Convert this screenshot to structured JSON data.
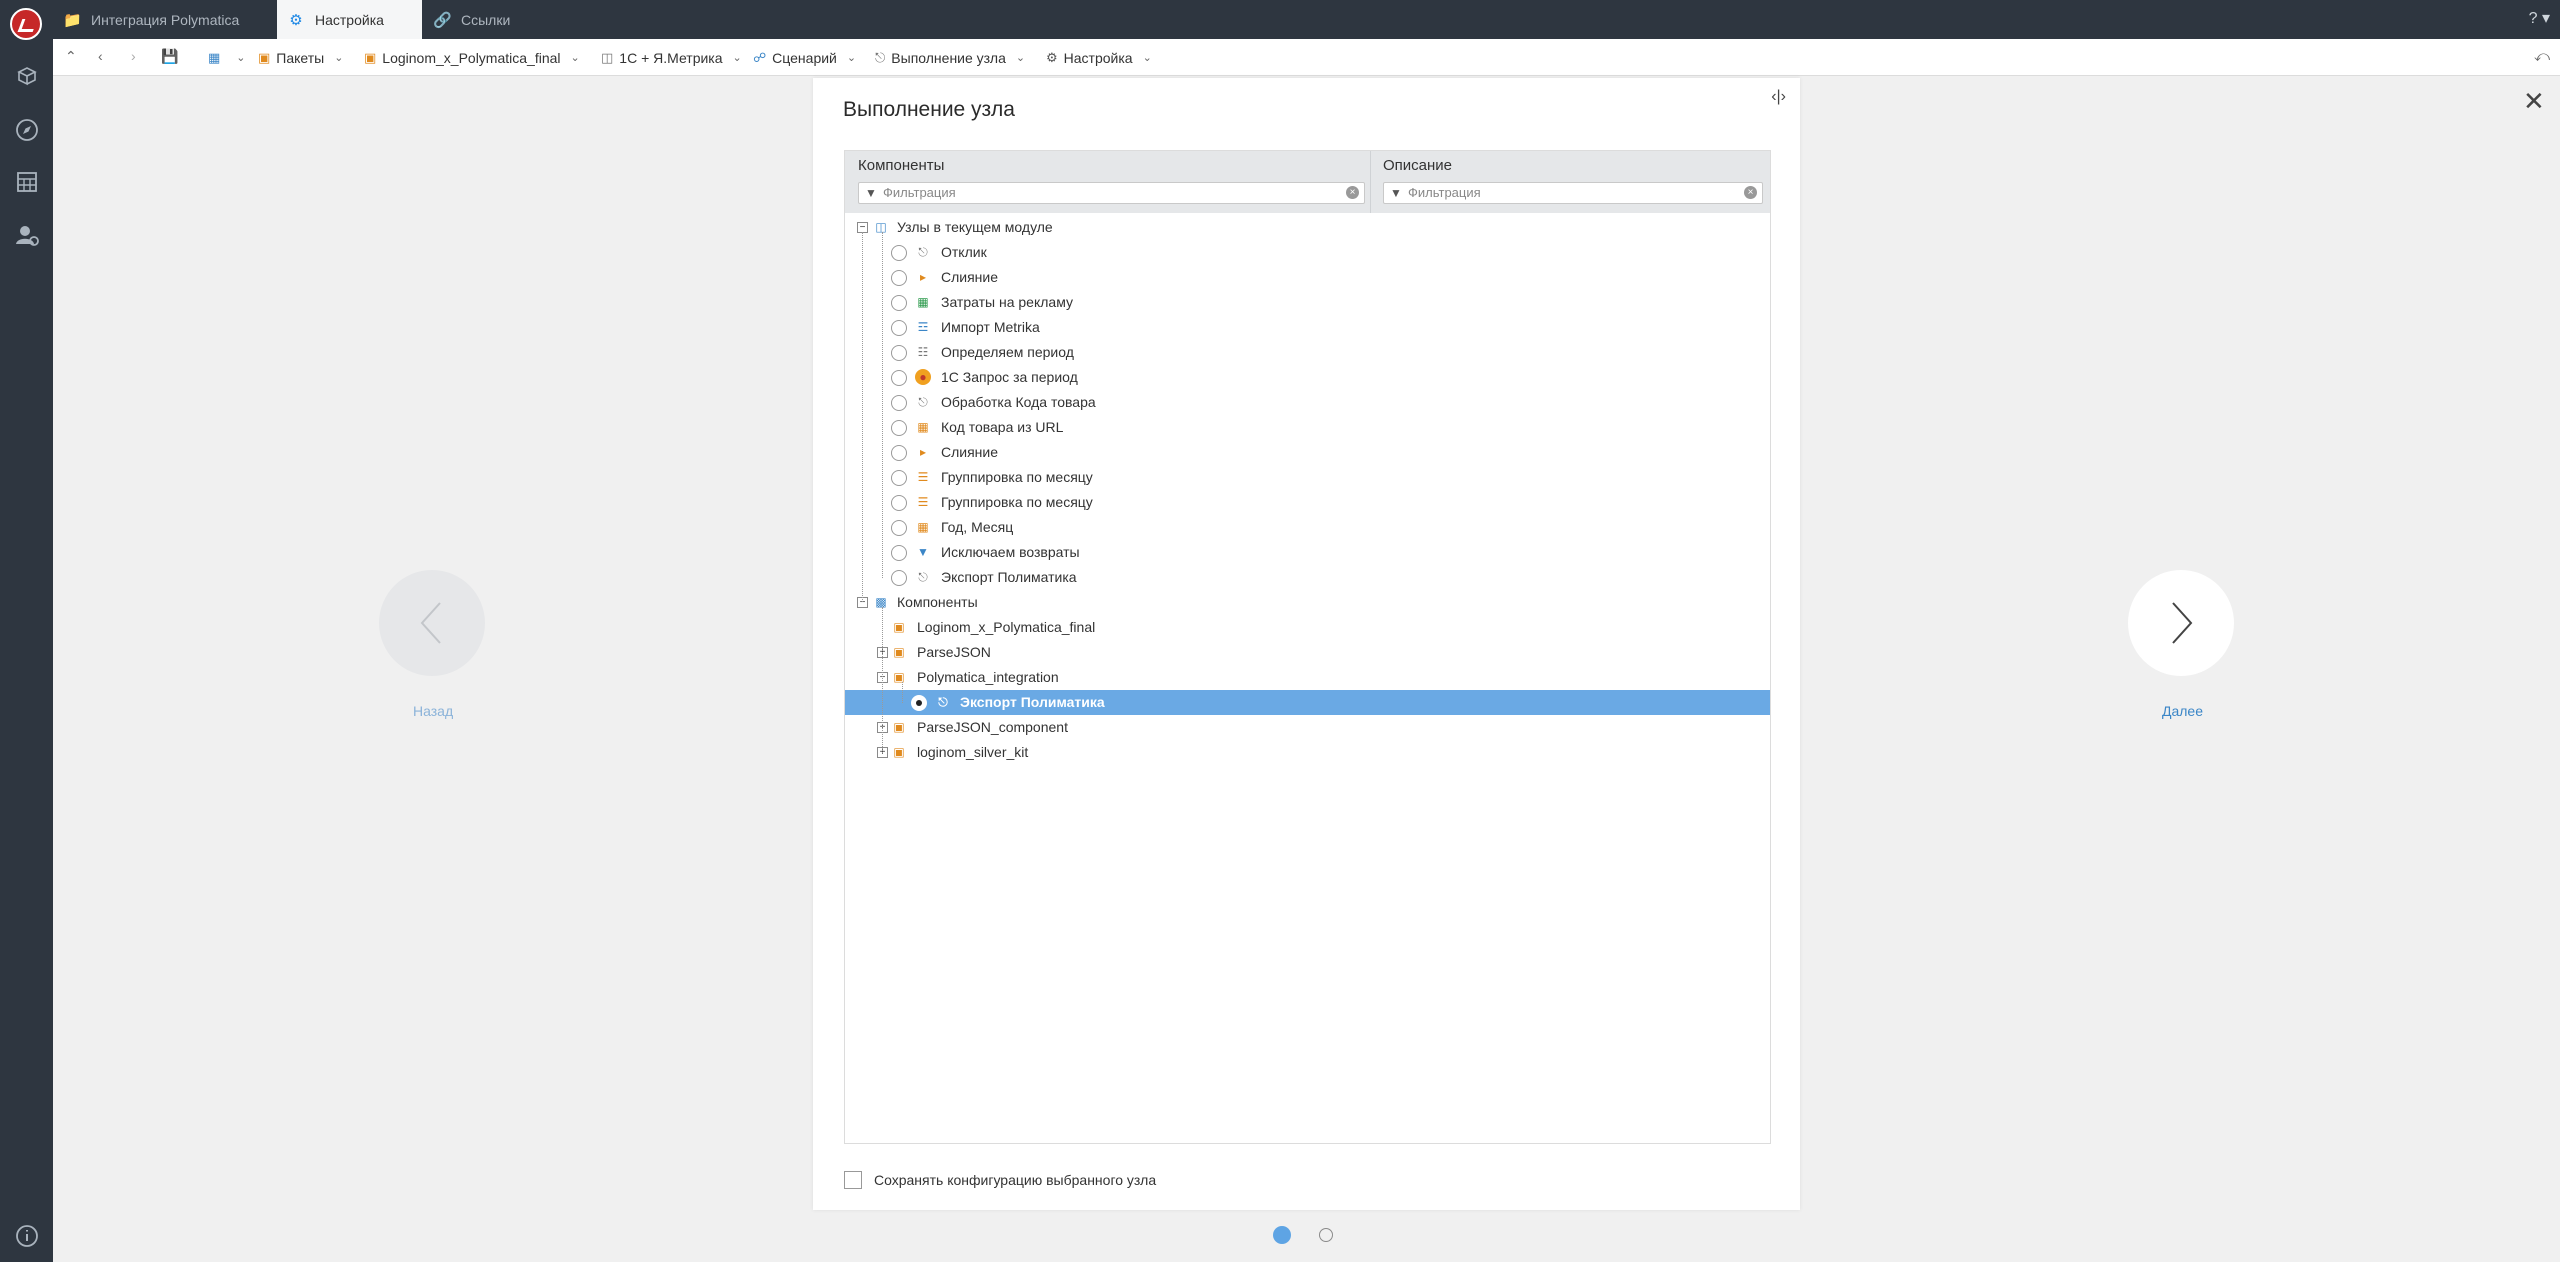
{
  "tabs": [
    {
      "label": "Интеграция Polymatica",
      "icon": "folder-icon"
    },
    {
      "label": "Настройка",
      "icon": "gear-icon",
      "active": true
    },
    {
      "label": "Ссылки",
      "icon": "link-icon"
    }
  ],
  "help": {
    "label": "?"
  },
  "breadcrumb": [
    {
      "label": "",
      "icon": "workspace-icon"
    },
    {
      "label": "Пакеты",
      "icon": "package-icon"
    },
    {
      "label": "Loginom_x_Polymatica_final",
      "icon": "package-icon"
    },
    {
      "label": "1С + Я.Метрика",
      "icon": "module-icon"
    },
    {
      "label": "Сценарий",
      "icon": "scenario-icon"
    },
    {
      "label": "Выполнение узла",
      "icon": "node-exec-icon"
    },
    {
      "label": "Настройка",
      "icon": "gear-icon"
    }
  ],
  "dialog": {
    "title": "Выполнение узла",
    "columns": {
      "components": "Компоненты",
      "description": "Описание"
    },
    "filter_placeholder": "Фильтрация",
    "tree": {
      "current_module_label": "Узлы в текущем модуле",
      "current_module_nodes": [
        "Отклик",
        "Слияние",
        "Затраты на рекламу",
        "Импорт Metrika",
        "Определяем период",
        "1С Запрос за период",
        "Обработка Кода товара",
        "Код товара из URL",
        "Слияние",
        "Группировка по месяцу",
        "Группировка по месяцу",
        "Год, Месяц",
        "Исключаем возвраты",
        "Экспорт Полиматика"
      ],
      "components_label": "Компоненты",
      "components": [
        "Loginom_x_Polymatica_final",
        "ParseJSON",
        "Polymatica_integration",
        "Экспорт Полиматика",
        "ParseJSON_component",
        "loginom_silver_kit"
      ]
    },
    "save_config_label": "Сохранять конфигурацию выбранного узла"
  },
  "nav": {
    "back_label": "Назад",
    "next_label": "Далее"
  },
  "colors": {
    "accent": "#6aa9e4",
    "sidebar_bg": "#2e3640",
    "link": "#3b86c7"
  }
}
